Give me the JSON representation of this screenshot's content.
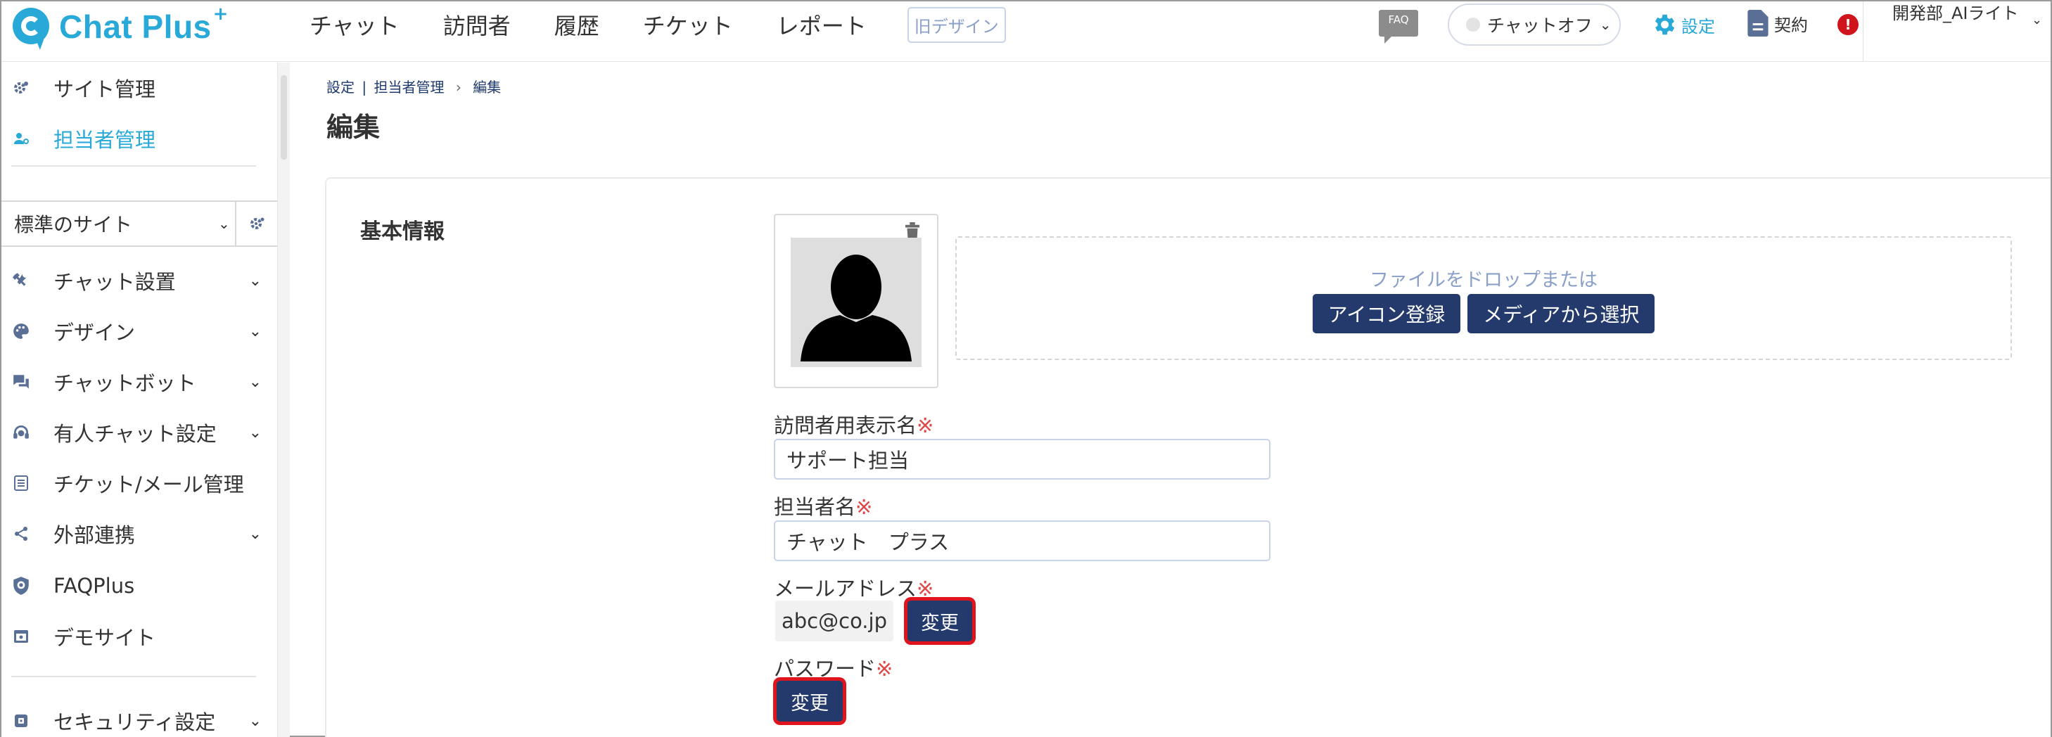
{
  "header": {
    "logo_text": "Chat Plus",
    "logo_plus": "+",
    "nav": [
      "チャット",
      "訪問者",
      "履歴",
      "チケット",
      "レポート"
    ],
    "old_design": "旧デザイン",
    "faq_icon_label": "FAQ",
    "chat_status": "チャットオフ",
    "settings_label": "設定",
    "contract_label": "契約",
    "alert_symbol": "!",
    "user_name": "開発部_AIライト"
  },
  "sidebar": {
    "top_items": [
      {
        "label": "サイト管理",
        "icon": "gear-person-icon",
        "active": false
      },
      {
        "label": "担当者管理",
        "icon": "user-gear-icon",
        "active": true
      }
    ],
    "site_select": "標準のサイト",
    "items": [
      {
        "label": "チャット設置",
        "icon": "tools-icon",
        "chevron": true
      },
      {
        "label": "デザイン",
        "icon": "palette-icon",
        "chevron": true
      },
      {
        "label": "チャットボット",
        "icon": "chat-bubbles-icon",
        "chevron": true
      },
      {
        "label": "有人チャット設定",
        "icon": "headset-icon",
        "chevron": true
      },
      {
        "label": "チケット/メール管理",
        "icon": "list-icon",
        "chevron": false
      },
      {
        "label": "外部連携",
        "icon": "share-icon",
        "chevron": true
      },
      {
        "label": "FAQPlus",
        "icon": "faq-shield-icon",
        "chevron": false
      },
      {
        "label": "デモサイト",
        "icon": "demo-site-icon",
        "chevron": false
      },
      {
        "label": "セキュリティ設定",
        "icon": "shield-icon",
        "chevron": true
      }
    ]
  },
  "breadcrumb": {
    "settings": "設定",
    "sep1": "|",
    "staff": "担当者管理",
    "sep2": "›",
    "current": "編集"
  },
  "page_title": "編集",
  "section_title": "基本情報",
  "dropzone": {
    "text": "ファイルをドロップまたは",
    "register_button": "アイコン登録",
    "media_button": "メディアから選択"
  },
  "fields": {
    "display_name_label": "訪問者用表示名",
    "display_name_value": "サポート担当",
    "staff_name_label": "担当者名",
    "staff_name_value": "チャット　プラス",
    "email_label": "メールアドレス",
    "email_value": "abc@co.jp",
    "password_label": "パスワード",
    "required_mark": "※",
    "change_button": "変更"
  },
  "colors": {
    "accent": "#29a9d8",
    "navy_button": "#243a6c",
    "highlight_outline": "#e0141c",
    "required": "#e04646"
  }
}
